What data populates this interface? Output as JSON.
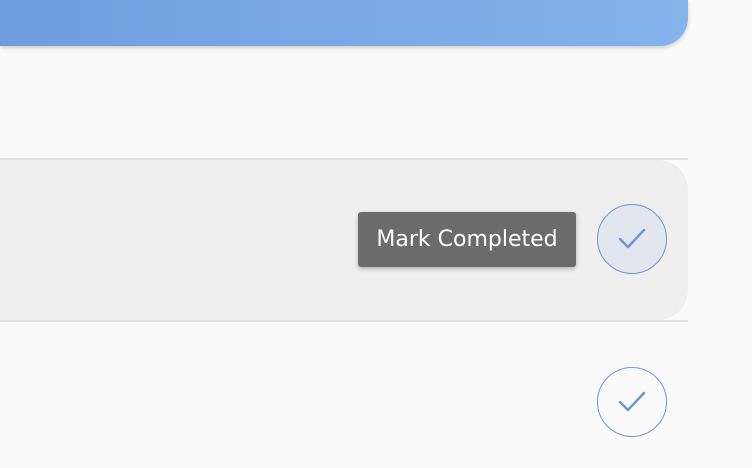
{
  "colors": {
    "header_gradient_start": "#6f9edf",
    "header_gradient_end": "#85b3ec",
    "page_background": "#fafafa",
    "hovered_row_background": "#efefef",
    "check_border": "#6a96d9",
    "check_hover_fill": "#e1e6ef",
    "tooltip_background": "#6b6b6b",
    "tooltip_text": "#ffffff",
    "divider": "#e0e0e0"
  },
  "tasks": [
    {
      "state": "hovered",
      "complete_button": {
        "icon": "checkmark-icon",
        "tooltip": "Mark Completed"
      }
    },
    {
      "state": "normal",
      "complete_button": {
        "icon": "checkmark-icon"
      }
    }
  ]
}
